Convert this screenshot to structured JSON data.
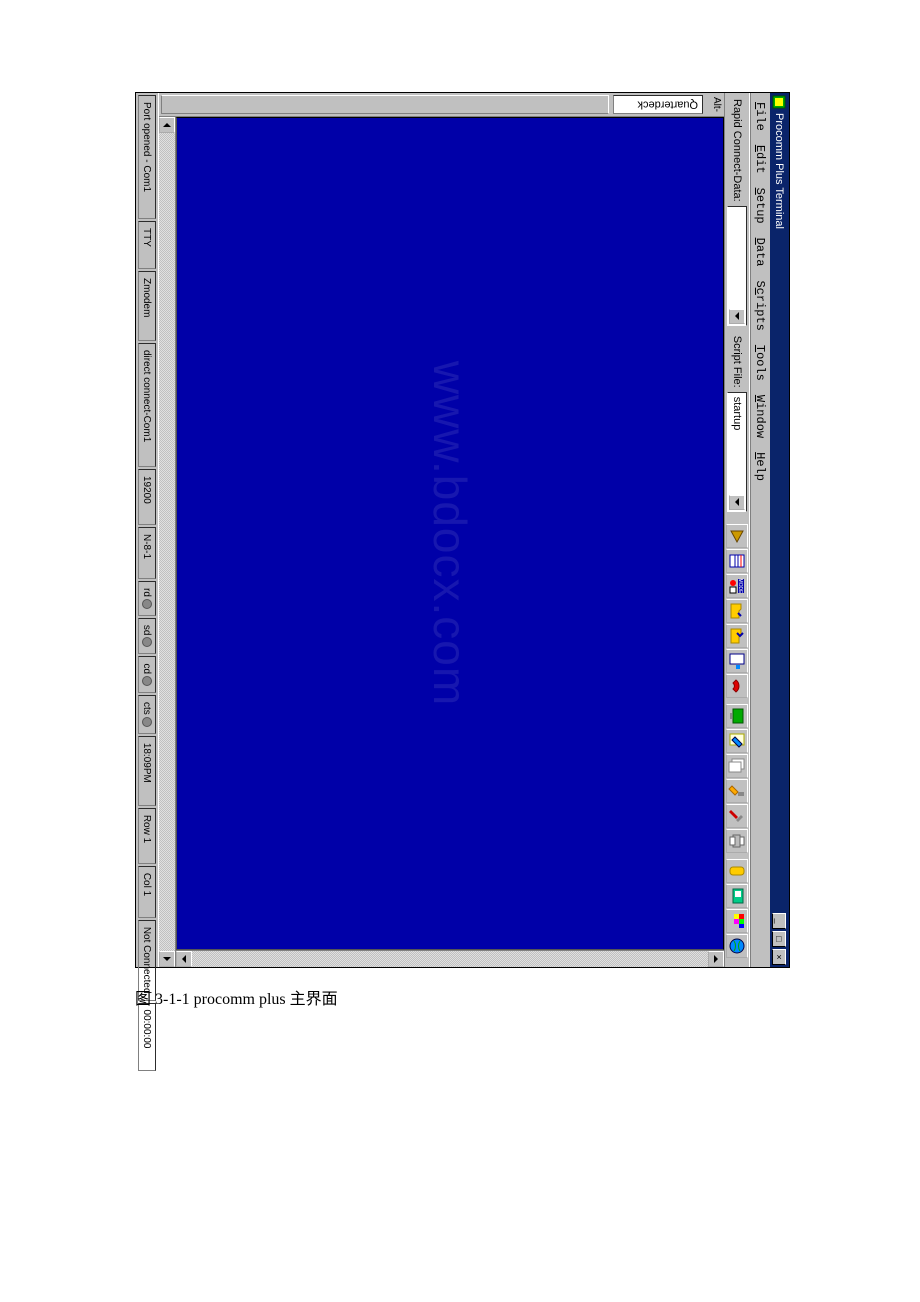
{
  "caption": "图 3-1-1 procomm plus 主界面",
  "window": {
    "title": "Procomm Plus Terminal",
    "min": "0",
    "max": "1",
    "close": "r"
  },
  "menu": [
    "File",
    "Edit",
    "Setup",
    "Data",
    "Scripts",
    "Tools",
    "Window",
    "Help"
  ],
  "toolrow": {
    "label1": "Rapid Connect-Data:",
    "combo1_placeholder": "",
    "label2": "Script File:",
    "combo2_value": "startup"
  },
  "side": {
    "host": "Quarterdeck",
    "alt": "Alt-"
  },
  "watermark": "www.bdocx.com",
  "status": {
    "p0": "Port opened - Com1",
    "p1": "TTY",
    "p2": "Zmodem",
    "p3": "direct connect-Com1",
    "p4": "19200",
    "p5": "N-8-1",
    "rd": "rd",
    "sd": "sd",
    "cd": "cd",
    "cts": "cts",
    "time": "18:09PM",
    "row": "Row 1",
    "col": "Col 1",
    "conn": "Not Connected",
    "dur": "00:00:00"
  }
}
